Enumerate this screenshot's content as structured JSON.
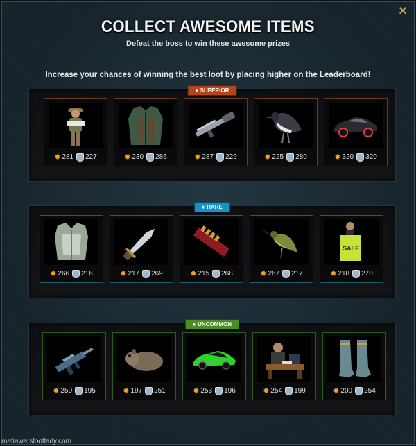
{
  "header": {
    "title": "COLLECT AWESOME ITEMS",
    "subtitle": "Defeat the boss to win these awesome prizes",
    "tip": "Increase your chances of winning the best loot by placing higher on the Leaderboard!"
  },
  "colors": {
    "superior": "#b5461a",
    "rare": "#1a92c6",
    "uncommon": "#4a8e22",
    "attack": "#f6a21c"
  },
  "tiers": [
    {
      "label": "SUPERIOR",
      "items": [
        {
          "icon": "hunter-figure",
          "attack": "281",
          "defense": "227"
        },
        {
          "icon": "tactical-vest",
          "attack": "230",
          "defense": "286"
        },
        {
          "icon": "shotgun",
          "attack": "287",
          "defense": "229"
        },
        {
          "icon": "bird",
          "attack": "225",
          "defense": "280"
        },
        {
          "icon": "sports-car",
          "attack": "320",
          "defense": "320"
        }
      ]
    },
    {
      "label": "RARE",
      "items": [
        {
          "icon": "armor-vest",
          "attack": "266",
          "defense": "216"
        },
        {
          "icon": "serrated-dagger",
          "attack": "217",
          "defense": "269"
        },
        {
          "icon": "ammo-belt",
          "attack": "215",
          "defense": "268"
        },
        {
          "icon": "hummingbird",
          "attack": "267",
          "defense": "217"
        },
        {
          "icon": "sale-man",
          "attack": "218",
          "defense": "270",
          "sign": "SALE"
        }
      ]
    },
    {
      "label": "UNCOMMON",
      "items": [
        {
          "icon": "assault-rifle",
          "attack": "250",
          "defense": "195"
        },
        {
          "icon": "rodent",
          "attack": "197",
          "defense": "251"
        },
        {
          "icon": "green-car",
          "attack": "253",
          "defense": "196"
        },
        {
          "icon": "desk-man",
          "attack": "254",
          "defense": "199"
        },
        {
          "icon": "boots",
          "attack": "200",
          "defense": "254"
        }
      ]
    }
  ],
  "footer": "mafiawarslootlady.com"
}
